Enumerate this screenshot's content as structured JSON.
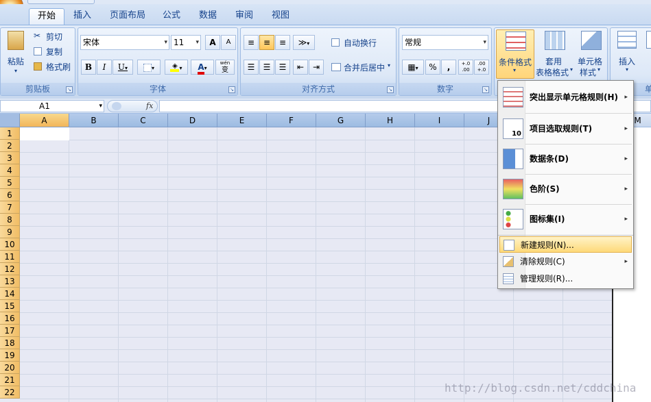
{
  "tabs": [
    {
      "label": "开始",
      "active": true
    },
    {
      "label": "插入"
    },
    {
      "label": "页面布局"
    },
    {
      "label": "公式"
    },
    {
      "label": "数据"
    },
    {
      "label": "审阅"
    },
    {
      "label": "视图"
    }
  ],
  "clipboard": {
    "paste": "粘贴",
    "cut": "剪切",
    "copy": "复制",
    "format_painter": "格式刷",
    "label": "剪贴板"
  },
  "font": {
    "name": "宋体",
    "size": "11",
    "grow": "A",
    "shrink": "A",
    "bold": "B",
    "italic": "I",
    "underline": "U",
    "color_glyph": "A",
    "phonetic": "wén",
    "phonetic_char": "变",
    "label": "字体"
  },
  "alignment": {
    "wrap": "自动换行",
    "merge": "合并后居中",
    "label": "对齐方式"
  },
  "number": {
    "format": "常规",
    "percent": "%",
    "comma": ",",
    "inc_dec": "+.0 .00",
    "dec_dec": ".00 +.0",
    "label": "数字"
  },
  "styles": {
    "conditional": "条件格式",
    "table_l1": "套用",
    "table_l2": "表格格式",
    "cell_l1": "单元格",
    "cell_l2": "样式"
  },
  "cells": {
    "insert": "插入",
    "label": "单"
  },
  "formula_bar": {
    "name_box": "A1",
    "fx": "fx"
  },
  "columns": [
    "A",
    "B",
    "C",
    "D",
    "E",
    "F",
    "G",
    "H",
    "I",
    "J"
  ],
  "column_m": "M",
  "rows": [
    "1",
    "2",
    "3",
    "4",
    "5",
    "6",
    "7",
    "8",
    "9",
    "10",
    "11",
    "12",
    "13",
    "14",
    "15",
    "16",
    "17",
    "18",
    "19",
    "20",
    "21",
    "22"
  ],
  "menu": {
    "items": [
      {
        "label": "突出显示单元格规则(H)",
        "icon": "highlight-rules-icon"
      },
      {
        "label": "项目选取规则(T)",
        "icon": "top-bottom-rules-icon",
        "icon_text": "10"
      },
      {
        "label": "数据条(D)",
        "icon": "data-bars-icon"
      },
      {
        "label": "色阶(S)",
        "icon": "color-scales-icon"
      },
      {
        "label": "图标集(I)",
        "icon": "icon-sets-icon"
      }
    ],
    "new_rule": "新建规则(N)...",
    "clear_rules": "清除规则(C)",
    "manage_rules": "管理规则(R)..."
  },
  "watermark": "http://blog.csdn.net/cddchina",
  "colors": {
    "accent": "#15428b",
    "selected_header": "#f2b65a",
    "menu_highlight": "#fed979"
  }
}
